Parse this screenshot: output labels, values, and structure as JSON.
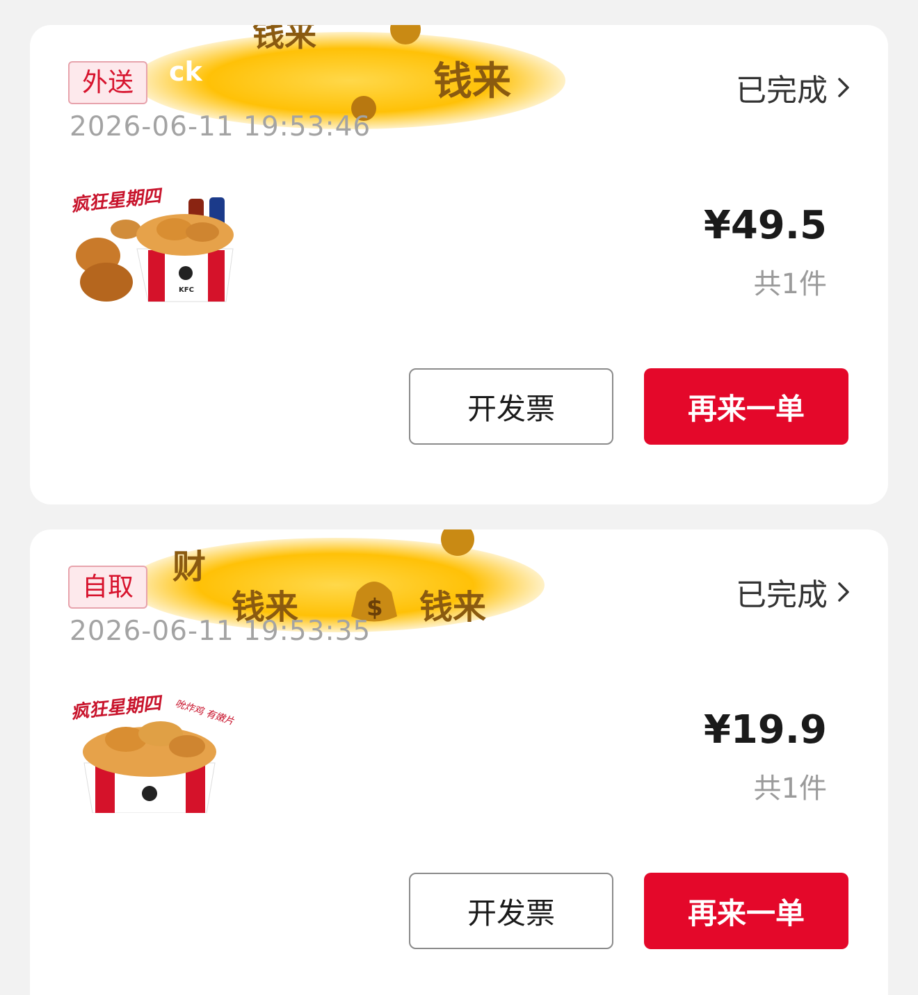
{
  "orders": [
    {
      "order_type": "外送",
      "timestamp": "2026-06-11 19:53:46",
      "status": "已完成",
      "banner_text": [
        "钱来",
        "钱来",
        "ck"
      ],
      "thumb_text": "疯狂星期四",
      "price": "¥49.5",
      "count": "共1件",
      "invoice_label": "开发票",
      "reorder_label": "再来一单"
    },
    {
      "order_type": "自取",
      "timestamp": "2026-06-11 19:53:35",
      "status": "已完成",
      "banner_text": [
        "财",
        "钱来",
        "钱来"
      ],
      "thumb_text": "疯狂星期四",
      "thumb_text_2": "吮炸鸡 有嫩片",
      "price": "¥19.9",
      "count": "共1件",
      "invoice_label": "开发票",
      "reorder_label": "再来一单"
    }
  ],
  "colors": {
    "accent_red": "#e4082a",
    "tag_bg": "#fde9ec",
    "tag_text": "#d7132d",
    "banner_yellow": "#ffc107"
  }
}
